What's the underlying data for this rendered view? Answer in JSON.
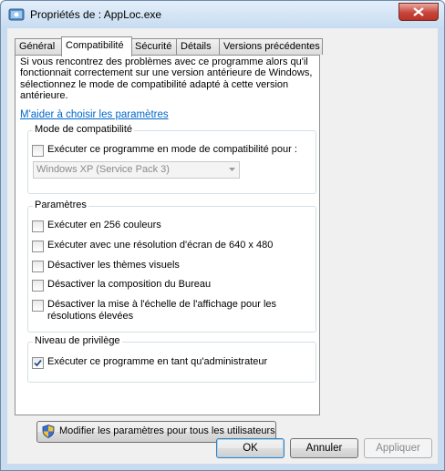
{
  "window": {
    "title": "Propriétés de : AppLoc.exe"
  },
  "tabs": [
    {
      "label": "Général",
      "active": false
    },
    {
      "label": "Compatibilité",
      "active": true
    },
    {
      "label": "Sécurité",
      "active": false
    },
    {
      "label": "Détails",
      "active": false
    },
    {
      "label": "Versions précédentes",
      "active": false
    }
  ],
  "intro": {
    "line1": "Si vous rencontrez des problèmes avec ce programme alors qu'il",
    "line2": "fonctionnait correctement sur une version antérieure de Windows,",
    "line3": "sélectionnez le mode de compatibilité adapté à cette version",
    "line4": "antérieure."
  },
  "help_link": "M'aider à choisir les paramètres",
  "compat_mode": {
    "title": "Mode de compatibilité",
    "checkbox_label": "Exécuter ce programme en mode de compatibilité pour :",
    "checked": false,
    "select_value": "Windows XP (Service Pack 3)"
  },
  "settings": {
    "title": "Paramètres",
    "items": [
      {
        "label": "Exécuter en 256 couleurs",
        "checked": false
      },
      {
        "label": "Exécuter avec une résolution d'écran de 640 x 480",
        "checked": false
      },
      {
        "label": "Désactiver les thèmes visuels",
        "checked": false
      },
      {
        "label": "Désactiver la composition du Bureau",
        "checked": false
      },
      {
        "label": "Désactiver la mise à l'échelle de l'affichage pour les",
        "label_line2": "résolutions élevées",
        "checked": false
      }
    ]
  },
  "privilege": {
    "title": "Niveau de privilège",
    "checkbox_label": "Exécuter ce programme en tant qu'administrateur",
    "checked": true
  },
  "all_users_button": "Modifier les paramètres pour tous les utilisateurs",
  "buttons": {
    "ok": "OK",
    "cancel": "Annuler",
    "apply": "Appliquer"
  },
  "colors": {
    "link": "#0066cc",
    "title_bar": "#c7dcf1",
    "close_button": "#c8453a"
  }
}
